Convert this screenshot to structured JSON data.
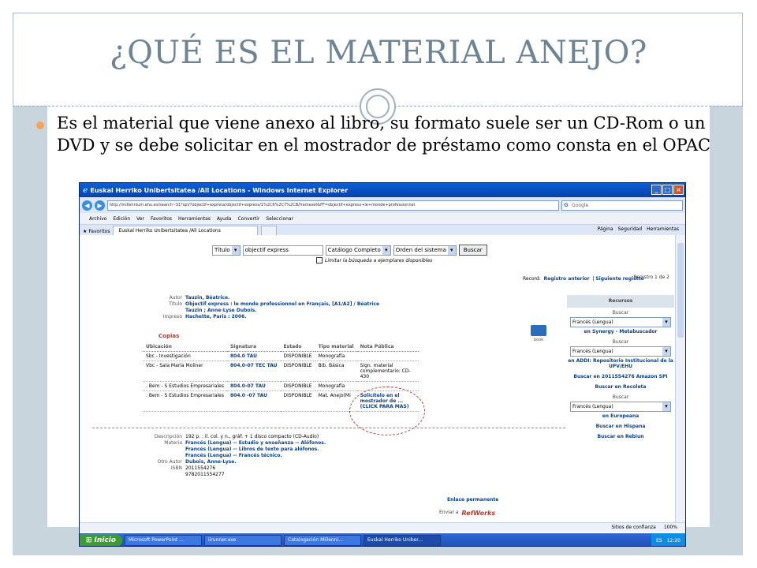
{
  "slide": {
    "title": "¿QUÉ ES EL MATERIAL ANEJO?",
    "bullet": "Es el material que viene anexo al libro, su formato suele ser un CD-Rom o un DVD y se debe solicitar en el mostrador de préstamo como consta en el OPAC",
    "colors": {
      "title": "#6d8494",
      "bullet_dot": "#f4a460",
      "band": "#c9d5dd"
    }
  },
  "browser": {
    "window_title": "Euskal Herriko Unibertsitatea /All Locations - Windows Internet Explorer",
    "address": "http://millennium.ehu.es/search~S1*spi/?objectif+express/objectif+express/1%2C6%2C7%2CB/frameset&FF=objectif+express+le+monde+professionnel",
    "search_placeholder": "Google",
    "menu": [
      "Archivo",
      "Edición",
      "Ver",
      "Favoritos",
      "Herramientas",
      "Ayuda"
    ],
    "toolbar_extra": [
      "Convertir",
      "Seleccionar"
    ],
    "favorites_label": "Favoritos",
    "tab_label": "Euskal Herriko Unibertsitatea /All Locations",
    "tab_tools": [
      "Página",
      "Seguridad",
      "Herramientas"
    ],
    "status": {
      "zone": "Sitios de confianza",
      "zoom": "100%"
    }
  },
  "opac": {
    "search": {
      "field": "Título",
      "query": "objectif express",
      "catalog": "Catálogo Completo",
      "order": "Orden del sistema",
      "button": "Buscar",
      "limit": "Limitar la búsqueda a ejemplares disponibles"
    },
    "record": {
      "label": "Record:",
      "prev": "Registro anterior",
      "next": "Siguiente registro",
      "count": "Registro 1 de 2"
    },
    "meta": [
      {
        "label": "Autor",
        "value": "Tauzin, Béatrice."
      },
      {
        "label": "Título",
        "value": "Objectif express : le monde professionnel en Français, [A1/A2] / Béatrice"
      },
      {
        "label": "",
        "value": "Tauzin ; Anne-Lyse Dubois."
      },
      {
        "label": "Impreso",
        "value": "Hachette, Paris : 2006."
      }
    ],
    "copias": "Copias",
    "holdings_headers": [
      "Ubicación",
      "Signatura",
      "Estado",
      "Tipo material",
      "Nota Pública"
    ],
    "holdings": [
      [
        "Sbc - Investigación",
        "804.0 TAU",
        "DISPONIBLE",
        "Monografía",
        ""
      ],
      [
        "Vbc - Sala María Moliner",
        "804.0-07 TEC TAU",
        "DISPONIBLE",
        "Bib. Básica",
        "Sign. material complementario: CD-430"
      ],
      [
        ". Bem - S Estudios Empresariales",
        "804.0-07 TAU",
        "DISPONIBLE",
        "Monografía",
        ""
      ],
      [
        ". Bem - S Estudios Empresariales",
        "804.0 -07 TAU",
        "DISPONIBLE",
        "Mat. Anejo(Mi",
        "Solicítelo en el mostrador de ... (CLICK PARA MAS)"
      ]
    ],
    "desc": [
      {
        "label": "Descripción",
        "value": "192 p. : il. col. y n., gráf. + 1 disco compacto (CD-Audio)"
      },
      {
        "label": "Materia",
        "value": "Francés (Lengua) -- Estudio y enseñanza -- Alófonos."
      },
      {
        "label": "",
        "value": "Francés (Lengua) -- Libros de texto para alófonos."
      },
      {
        "label": "",
        "value": "Francés (Lengua) -- Francés técnico."
      },
      {
        "label": "Otro Autor",
        "value": "Dubois, Anne-Lyse."
      },
      {
        "label": "ISBN",
        "value": "2011554276"
      },
      {
        "label": "",
        "value": "9782011554277"
      }
    ],
    "book_label": "book",
    "resources": {
      "title": "Recursos",
      "blocks": [
        {
          "label": "Buscar",
          "select": "Francés (Lengua)",
          "link": "en Synergy - Metabuscador"
        },
        {
          "label": "Buscar",
          "select": "Francés (Lengua)",
          "link": "en ADDI: Repositorio Institucional de la UPV/EHU"
        },
        {
          "label": "",
          "select": "",
          "link": "Buscar en 2011554276 Amazon SPI"
        },
        {
          "label": "",
          "select": "",
          "link": "Buscar en Recoleta"
        },
        {
          "label": "Buscar",
          "select": "Francés (Lengua)",
          "link": "en Europeana"
        },
        {
          "label": "",
          "select": "",
          "link": "Buscar en Hispana"
        },
        {
          "label": "",
          "select": "",
          "link": "Buscar en Rebiun"
        }
      ]
    },
    "enlace": "Enlace permanente",
    "enviar": "Enviar a",
    "refworks": "RefWorks"
  },
  "taskbar": {
    "start": "Inicio",
    "items": [
      "Microsoft PowerPoint ...",
      "iirunner.exe",
      "Catalogación Millenni...",
      "Euskal Herriko Uniber..."
    ],
    "lang": "ES",
    "time": "12:20"
  }
}
